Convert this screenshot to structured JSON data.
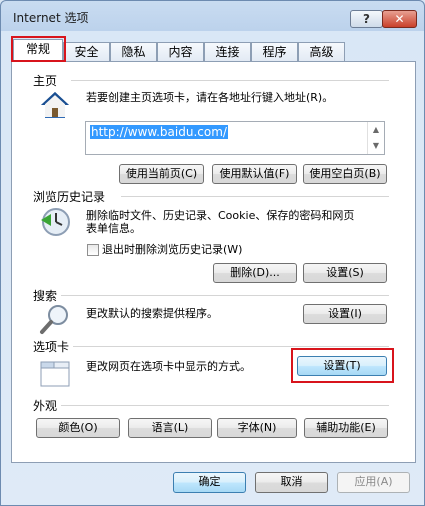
{
  "window": {
    "title": "Internet 选项",
    "help": "?",
    "close": "✕"
  },
  "tabs": [
    "常规",
    "安全",
    "隐私",
    "内容",
    "连接",
    "程序",
    "高级"
  ],
  "homepage": {
    "heading": "主页",
    "description": "若要创建主页选项卡，请在各地址行键入地址(R)。",
    "url": "http://www.baidu.com/",
    "buttons": {
      "current": "使用当前页(C)",
      "default": "使用默认值(F)",
      "blank": "使用空白页(B)"
    }
  },
  "history": {
    "heading": "浏览历史记录",
    "description_line1": "删除临时文件、历史记录、Cookie、保存的密码和网页",
    "description_line2": "表单信息。",
    "checkbox_label": "退出时删除浏览历史记录(W)",
    "checkbox_checked": false,
    "delete_button": "删除(D)...",
    "settings_button": "设置(S)"
  },
  "search": {
    "heading": "搜索",
    "description": "更改默认的搜索提供程序。",
    "settings_button": "设置(I)"
  },
  "tabbed": {
    "heading": "选项卡",
    "description": "更改网页在选项卡中显示的方式。",
    "settings_button": "设置(T)"
  },
  "appearance": {
    "heading": "外观",
    "buttons": {
      "colors": "颜色(O)",
      "languages": "语言(L)",
      "fonts": "字体(N)",
      "accessibility": "辅助功能(E)"
    }
  },
  "footer": {
    "ok": "确定",
    "cancel": "取消",
    "apply": "应用(A)"
  },
  "icons": {
    "homepage": "house-icon",
    "history": "history-clock-icon",
    "search": "magnifier-icon",
    "tabs": "tabs-icon"
  },
  "colors": {
    "highlight": "#d8141c",
    "selection": "#3399ff"
  }
}
